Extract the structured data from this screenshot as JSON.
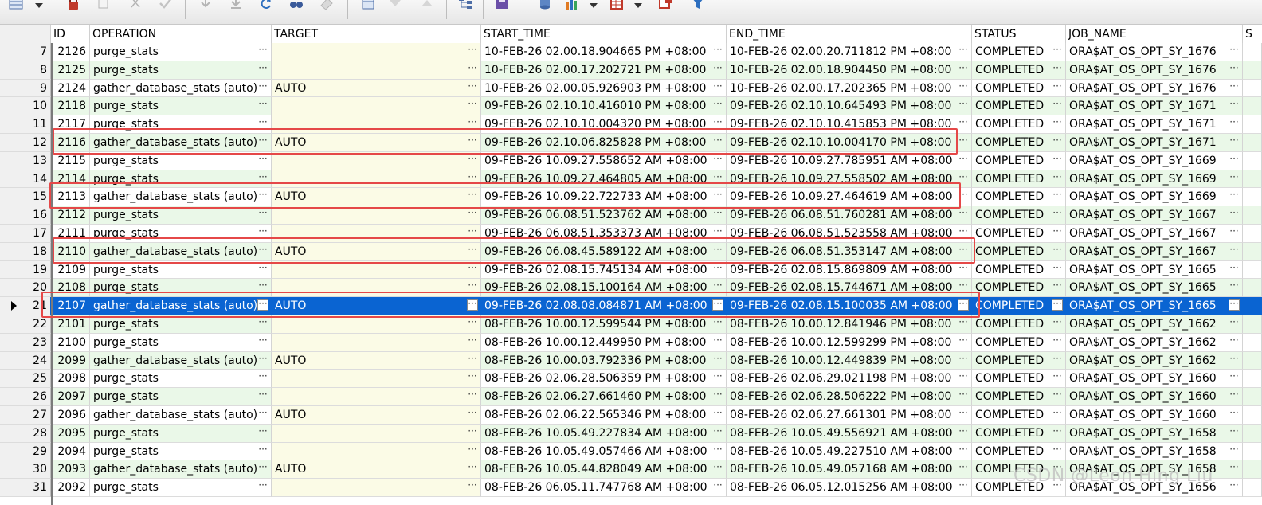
{
  "columns": [
    {
      "key": "id",
      "label": "ID"
    },
    {
      "key": "operation",
      "label": "OPERATION"
    },
    {
      "key": "target",
      "label": "TARGET"
    },
    {
      "key": "start_time",
      "label": "START_TIME"
    },
    {
      "key": "end_time",
      "label": "END_TIME"
    },
    {
      "key": "status",
      "label": "STATUS"
    },
    {
      "key": "job_name",
      "label": "JOB_NAME"
    },
    {
      "key": "more",
      "label": "S"
    }
  ],
  "ellipsis_glyph": "···",
  "selected_row_number": 21,
  "highlighted_row_numbers": [
    12,
    15,
    18,
    21
  ],
  "rows": [
    {
      "rn": "7",
      "id": "2126",
      "operation": "purge_stats",
      "target": "",
      "start_time": "10-FEB-26 02.00.18.904665 PM +08:00",
      "end_time": "10-FEB-26 02.00.20.711812 PM +08:00",
      "status": "COMPLETED",
      "job_name": "ORA$AT_OS_OPT_SY_1676"
    },
    {
      "rn": "8",
      "id": "2125",
      "operation": "purge_stats",
      "target": "",
      "start_time": "10-FEB-26 02.00.17.202721 PM +08:00",
      "end_time": "10-FEB-26 02.00.18.904450 PM +08:00",
      "status": "COMPLETED",
      "job_name": "ORA$AT_OS_OPT_SY_1676"
    },
    {
      "rn": "9",
      "id": "2124",
      "operation": "gather_database_stats (auto)",
      "target": "AUTO",
      "start_time": "10-FEB-26 02.00.05.926903 PM +08:00",
      "end_time": "10-FEB-26 02.00.17.202365 PM +08:00",
      "status": "COMPLETED",
      "job_name": "ORA$AT_OS_OPT_SY_1676"
    },
    {
      "rn": "10",
      "id": "2118",
      "operation": "purge_stats",
      "target": "",
      "start_time": "09-FEB-26 02.10.10.416010 PM +08:00",
      "end_time": "09-FEB-26 02.10.10.645493 PM +08:00",
      "status": "COMPLETED",
      "job_name": "ORA$AT_OS_OPT_SY_1671"
    },
    {
      "rn": "11",
      "id": "2117",
      "operation": "purge_stats",
      "target": "",
      "start_time": "09-FEB-26 02.10.10.004320 PM +08:00",
      "end_time": "09-FEB-26 02.10.10.415853 PM +08:00",
      "status": "COMPLETED",
      "job_name": "ORA$AT_OS_OPT_SY_1671"
    },
    {
      "rn": "12",
      "id": "2116",
      "operation": "gather_database_stats (auto)",
      "target": "AUTO",
      "start_time": "09-FEB-26 02.10.06.825828 PM +08:00",
      "end_time": "09-FEB-26 02.10.10.004170 PM +08:00",
      "status": "COMPLETED",
      "job_name": "ORA$AT_OS_OPT_SY_1671"
    },
    {
      "rn": "13",
      "id": "2115",
      "operation": "purge_stats",
      "target": "",
      "start_time": "09-FEB-26 10.09.27.558652 AM +08:00",
      "end_time": "09-FEB-26 10.09.27.785951 AM +08:00",
      "status": "COMPLETED",
      "job_name": "ORA$AT_OS_OPT_SY_1669"
    },
    {
      "rn": "14",
      "id": "2114",
      "operation": "purge_stats",
      "target": "",
      "start_time": "09-FEB-26 10.09.27.464805 AM +08:00",
      "end_time": "09-FEB-26 10.09.27.558502 AM +08:00",
      "status": "COMPLETED",
      "job_name": "ORA$AT_OS_OPT_SY_1669"
    },
    {
      "rn": "15",
      "id": "2113",
      "operation": "gather_database_stats (auto)",
      "target": "AUTO",
      "start_time": "09-FEB-26 10.09.22.722733 AM +08:00",
      "end_time": "09-FEB-26 10.09.27.464619 AM +08:00",
      "status": "COMPLETED",
      "job_name": "ORA$AT_OS_OPT_SY_1669"
    },
    {
      "rn": "16",
      "id": "2112",
      "operation": "purge_stats",
      "target": "",
      "start_time": "09-FEB-26 06.08.51.523762 AM +08:00",
      "end_time": "09-FEB-26 06.08.51.760281 AM +08:00",
      "status": "COMPLETED",
      "job_name": "ORA$AT_OS_OPT_SY_1667"
    },
    {
      "rn": "17",
      "id": "2111",
      "operation": "purge_stats",
      "target": "",
      "start_time": "09-FEB-26 06.08.51.353373 AM +08:00",
      "end_time": "09-FEB-26 06.08.51.523558 AM +08:00",
      "status": "COMPLETED",
      "job_name": "ORA$AT_OS_OPT_SY_1667"
    },
    {
      "rn": "18",
      "id": "2110",
      "operation": "gather_database_stats (auto)",
      "target": "AUTO",
      "start_time": "09-FEB-26 06.08.45.589122 AM +08:00",
      "end_time": "09-FEB-26 06.08.51.353147 AM +08:00",
      "status": "COMPLETED",
      "job_name": "ORA$AT_OS_OPT_SY_1667"
    },
    {
      "rn": "19",
      "id": "2109",
      "operation": "purge_stats",
      "target": "",
      "start_time": "09-FEB-26 02.08.15.745134 AM +08:00",
      "end_time": "09-FEB-26 02.08.15.869809 AM +08:00",
      "status": "COMPLETED",
      "job_name": "ORA$AT_OS_OPT_SY_1665"
    },
    {
      "rn": "20",
      "id": "2108",
      "operation": "purge_stats",
      "target": "",
      "start_time": "09-FEB-26 02.08.15.100164 AM +08:00",
      "end_time": "09-FEB-26 02.08.15.744671 AM +08:00",
      "status": "COMPLETED",
      "job_name": "ORA$AT_OS_OPT_SY_1665"
    },
    {
      "rn": "21",
      "id": "2107",
      "operation": "gather_database_stats (auto)",
      "target": "AUTO",
      "start_time": "09-FEB-26 02.08.08.084871 AM +08:00",
      "end_time": "09-FEB-26 02.08.15.100035 AM +08:00",
      "status": "COMPLETED",
      "job_name": "ORA$AT_OS_OPT_SY_1665"
    },
    {
      "rn": "22",
      "id": "2101",
      "operation": "purge_stats",
      "target": "",
      "start_time": "08-FEB-26 10.00.12.599544 PM +08:00",
      "end_time": "08-FEB-26 10.00.12.841946 PM +08:00",
      "status": "COMPLETED",
      "job_name": "ORA$AT_OS_OPT_SY_1662"
    },
    {
      "rn": "23",
      "id": "2100",
      "operation": "purge_stats",
      "target": "",
      "start_time": "08-FEB-26 10.00.12.449950 PM +08:00",
      "end_time": "08-FEB-26 10.00.12.599299 PM +08:00",
      "status": "COMPLETED",
      "job_name": "ORA$AT_OS_OPT_SY_1662"
    },
    {
      "rn": "24",
      "id": "2099",
      "operation": "gather_database_stats (auto)",
      "target": "AUTO",
      "start_time": "08-FEB-26 10.00.03.792336 PM +08:00",
      "end_time": "08-FEB-26 10.00.12.449839 PM +08:00",
      "status": "COMPLETED",
      "job_name": "ORA$AT_OS_OPT_SY_1662"
    },
    {
      "rn": "25",
      "id": "2098",
      "operation": "purge_stats",
      "target": "",
      "start_time": "08-FEB-26 02.06.28.506359 PM +08:00",
      "end_time": "08-FEB-26 02.06.29.021198 PM +08:00",
      "status": "COMPLETED",
      "job_name": "ORA$AT_OS_OPT_SY_1660"
    },
    {
      "rn": "26",
      "id": "2097",
      "operation": "purge_stats",
      "target": "",
      "start_time": "08-FEB-26 02.06.27.661460 PM +08:00",
      "end_time": "08-FEB-26 02.06.28.506222 PM +08:00",
      "status": "COMPLETED",
      "job_name": "ORA$AT_OS_OPT_SY_1660"
    },
    {
      "rn": "27",
      "id": "2096",
      "operation": "gather_database_stats (auto)",
      "target": "AUTO",
      "start_time": "08-FEB-26 02.06.22.565346 PM +08:00",
      "end_time": "08-FEB-26 02.06.27.661301 PM +08:00",
      "status": "COMPLETED",
      "job_name": "ORA$AT_OS_OPT_SY_1660"
    },
    {
      "rn": "28",
      "id": "2095",
      "operation": "purge_stats",
      "target": "",
      "start_time": "08-FEB-26 10.05.49.227834 AM +08:00",
      "end_time": "08-FEB-26 10.05.49.556921 AM +08:00",
      "status": "COMPLETED",
      "job_name": "ORA$AT_OS_OPT_SY_1658"
    },
    {
      "rn": "29",
      "id": "2094",
      "operation": "purge_stats",
      "target": "",
      "start_time": "08-FEB-26 10.05.49.057466 AM +08:00",
      "end_time": "08-FEB-26 10.05.49.227510 AM +08:00",
      "status": "COMPLETED",
      "job_name": "ORA$AT_OS_OPT_SY_1658"
    },
    {
      "rn": "30",
      "id": "2093",
      "operation": "gather_database_stats (auto)",
      "target": "AUTO",
      "start_time": "08-FEB-26 10.05.44.828049 AM +08:00",
      "end_time": "08-FEB-26 10.05.49.057168 AM +08:00",
      "status": "COMPLETED",
      "job_name": "ORA$AT_OS_OPT_SY_1658"
    },
    {
      "rn": "31",
      "id": "2092",
      "operation": "purge_stats",
      "target": "",
      "start_time": "08-FEB-26 06.05.11.747768 AM +08:00",
      "end_time": "08-FEB-26 06.05.12.015256 AM +08:00",
      "status": "COMPLETED",
      "job_name": "ORA$AT_OS_OPT_SY_1656"
    }
  ],
  "watermark": "CSDN @Leon Hing Liu",
  "colors": {
    "selection": "#0a64d2",
    "highlight_box": "#e54848",
    "even_row": "#eaf8e8",
    "target_col": "#fbfbe6"
  },
  "toolbar_icons": [
    "grid-view-icon",
    "lock-icon",
    "copy-icon",
    "cut-icon",
    "check-icon",
    "arrow-down-icon",
    "arrow-down-end-icon",
    "refresh-icon",
    "binoculars-icon",
    "eraser-icon",
    "table-edit-icon",
    "triangle-down-icon",
    "triangle-up-icon",
    "tree-icon",
    "save-icon",
    "database-icon",
    "bar-chart-icon",
    "table-grid-icon",
    "export-table-icon",
    "filter-icon"
  ]
}
